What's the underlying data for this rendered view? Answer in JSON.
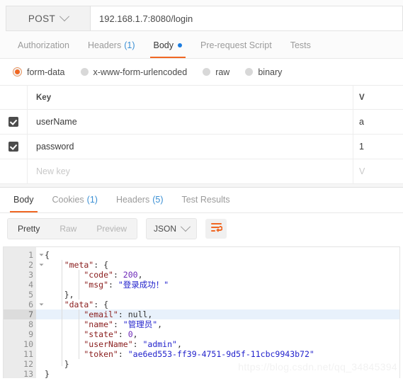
{
  "request_bar": {
    "method": "POST",
    "method_caret_icon": "chevron-down-icon",
    "url": "192.168.1.7:8080/login"
  },
  "request_tabs": [
    {
      "label": "Authorization",
      "count": "",
      "active": false,
      "dot": false
    },
    {
      "label": "Headers",
      "count": "(1)",
      "active": false,
      "dot": false
    },
    {
      "label": "Body",
      "count": "",
      "active": true,
      "dot": true
    },
    {
      "label": "Pre-request Script",
      "count": "",
      "active": false,
      "dot": false
    },
    {
      "label": "Tests",
      "count": "",
      "active": false,
      "dot": false
    }
  ],
  "body_types": [
    {
      "label": "form-data",
      "selected": true
    },
    {
      "label": "x-www-form-urlencoded",
      "selected": false
    },
    {
      "label": "raw",
      "selected": false
    },
    {
      "label": "binary",
      "selected": false
    }
  ],
  "kv_table": {
    "headers": {
      "key": "Key",
      "value": "V"
    },
    "rows": [
      {
        "checked": true,
        "key": "userName",
        "value": "a"
      },
      {
        "checked": true,
        "key": "password",
        "value": "1"
      }
    ],
    "new_row": {
      "key_placeholder": "New key",
      "value_placeholder": "V"
    }
  },
  "response_tabs": [
    {
      "label": "Body",
      "count": "",
      "active": true
    },
    {
      "label": "Cookies",
      "count": "(1)",
      "active": false
    },
    {
      "label": "Headers",
      "count": "(5)",
      "active": false
    },
    {
      "label": "Test Results",
      "count": "",
      "active": false
    }
  ],
  "response_toolbar": {
    "view_modes": [
      {
        "label": "Pretty",
        "active": true
      },
      {
        "label": "Raw",
        "active": false
      },
      {
        "label": "Preview",
        "active": false
      }
    ],
    "format": "JSON",
    "format_caret_icon": "chevron-down-icon",
    "wrap_button_icon": "wrap-text-icon"
  },
  "code_viewer": {
    "active_line": 7,
    "lines": [
      {
        "n": "1",
        "fold": true,
        "tokens": [
          {
            "t": "{",
            "c": "punct"
          }
        ]
      },
      {
        "n": "2",
        "fold": true,
        "tokens": [
          {
            "t": "    \"meta\"",
            "c": "key"
          },
          {
            "t": ": {",
            "c": "punct"
          }
        ]
      },
      {
        "n": "3",
        "fold": false,
        "tokens": [
          {
            "t": "        \"code\"",
            "c": "key"
          },
          {
            "t": ": ",
            "c": "punct"
          },
          {
            "t": "200",
            "c": "num"
          },
          {
            "t": ",",
            "c": "punct"
          }
        ]
      },
      {
        "n": "4",
        "fold": false,
        "tokens": [
          {
            "t": "        \"msg\"",
            "c": "key"
          },
          {
            "t": ": ",
            "c": "punct"
          },
          {
            "t": "\"登录成功！\"",
            "c": "str"
          }
        ]
      },
      {
        "n": "5",
        "fold": false,
        "tokens": [
          {
            "t": "    },",
            "c": "punct"
          }
        ]
      },
      {
        "n": "6",
        "fold": true,
        "tokens": [
          {
            "t": "    \"data\"",
            "c": "key"
          },
          {
            "t": ": {",
            "c": "punct"
          }
        ]
      },
      {
        "n": "7",
        "fold": false,
        "tokens": [
          {
            "t": "        \"email\"",
            "c": "key"
          },
          {
            "t": ": ",
            "c": "punct"
          },
          {
            "t": "null",
            "c": "null"
          },
          {
            "t": ",",
            "c": "punct"
          }
        ]
      },
      {
        "n": "8",
        "fold": false,
        "tokens": [
          {
            "t": "        \"name\"",
            "c": "key"
          },
          {
            "t": ": ",
            "c": "punct"
          },
          {
            "t": "\"管理员\"",
            "c": "str"
          },
          {
            "t": ",",
            "c": "punct"
          }
        ]
      },
      {
        "n": "9",
        "fold": false,
        "tokens": [
          {
            "t": "        \"state\"",
            "c": "key"
          },
          {
            "t": ": ",
            "c": "punct"
          },
          {
            "t": "0",
            "c": "num"
          },
          {
            "t": ",",
            "c": "punct"
          }
        ]
      },
      {
        "n": "10",
        "fold": false,
        "tokens": [
          {
            "t": "        \"userName\"",
            "c": "key"
          },
          {
            "t": ": ",
            "c": "punct"
          },
          {
            "t": "\"admin\"",
            "c": "str"
          },
          {
            "t": ",",
            "c": "punct"
          }
        ]
      },
      {
        "n": "11",
        "fold": false,
        "tokens": [
          {
            "t": "        \"token\"",
            "c": "key"
          },
          {
            "t": ": ",
            "c": "punct"
          },
          {
            "t": "\"ae6ed553-ff39-4751-9d5f-11cbc9943b72\"",
            "c": "str"
          }
        ]
      },
      {
        "n": "12",
        "fold": false,
        "tokens": [
          {
            "t": "    }",
            "c": "punct"
          }
        ]
      },
      {
        "n": "13",
        "fold": false,
        "tokens": [
          {
            "t": "}",
            "c": "punct"
          }
        ]
      }
    ]
  },
  "watermark": "https://blog.csdn.net/qq_34845394",
  "colors": {
    "accent_orange": "#f06723",
    "link_blue": "#3a8fd4",
    "dot_blue": "#1b7ce0",
    "checkbox_dark": "#4c4c4c",
    "json_key": "#8b2020",
    "json_string": "#2222cc",
    "json_number": "#6c28b8"
  }
}
